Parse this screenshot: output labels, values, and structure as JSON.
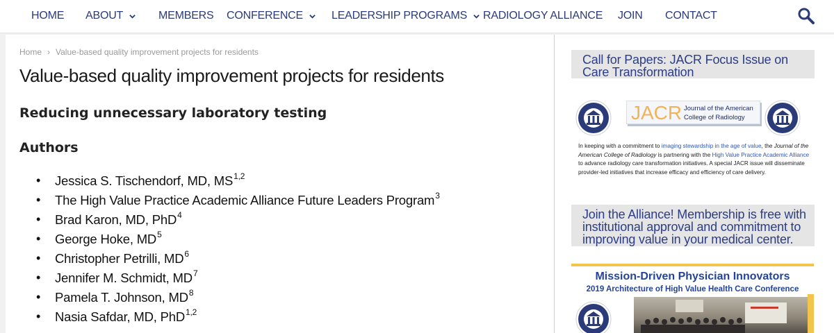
{
  "nav": {
    "items": [
      {
        "label": "HOME",
        "dropdown": false
      },
      {
        "label": "ABOUT",
        "dropdown": true
      },
      {
        "label": "MEMBERS",
        "dropdown": false
      },
      {
        "label": "CONFERENCE",
        "dropdown": true
      },
      {
        "label": "LEADERSHIP PROGRAMS",
        "dropdown": true
      },
      {
        "label": "RADIOLOGY ALLIANCE",
        "dropdown": false
      },
      {
        "label": "JOIN",
        "dropdown": false
      },
      {
        "label": "CONTACT",
        "dropdown": false
      }
    ],
    "search_icon": "search-icon",
    "color": "#2b3a78"
  },
  "breadcrumb": {
    "home": "Home",
    "separator": "›",
    "current": "Value-based quality improvement projects for residents"
  },
  "page": {
    "title": "Value-based quality improvement projects for residents",
    "subtitle": "Reducing unnecessary laboratory testing",
    "authors_heading": "Authors",
    "authors": [
      {
        "name": "Jessica S. Tischendorf, MD, MS",
        "sup": "1,2"
      },
      {
        "name": "The High Value Practice Academic Alliance Future Leaders Program",
        "sup": "3"
      },
      {
        "name": "Brad Karon, MD, PhD",
        "sup": "4"
      },
      {
        "name": "George Hoke, MD",
        "sup": "5"
      },
      {
        "name": "Christopher Petrilli, MD",
        "sup": "6"
      },
      {
        "name": "Jennifer M. Schmidt, MD",
        "sup": "7"
      },
      {
        "name": "Pamela T. Johnson, MD",
        "sup": "8"
      },
      {
        "name": "Nasia Safdar, MD, PhD",
        "sup": "1,2"
      }
    ]
  },
  "sidebar": {
    "call_for_papers": {
      "line1": "Call for Papers: JACR Focus Issue on",
      "line2": "Care Transformation"
    },
    "jacr": {
      "logo_text": "JACR",
      "logo_sub_1": "Journal of the American",
      "logo_sub_2": "College of Radiology",
      "desc_1": "In keeping with a commitment to ",
      "desc_link_1": "imaging stewardship in the age of value",
      "desc_2": ", the ",
      "desc_italic": "Journal of the American College of Radiology",
      "desc_3": " is partnering with the ",
      "desc_link_2": "High Value Practice Academic Alliance",
      "desc_4": " to advance radiology care transformation initiatives. A special JACR issue will disseminate provider-led initiatives that increase efficacy and efficiency of care delivery."
    },
    "join": {
      "line1": "Join the Alliance! Membership is free with",
      "line2": "institutional approval and commitment to",
      "line3": "improving value in your medical center."
    },
    "banner": {
      "title": "Mission-Driven Physician Innovators",
      "subtitle": "2019 Architecture of High Value Health Care Conference"
    },
    "seal_icon": "seal-icon"
  }
}
